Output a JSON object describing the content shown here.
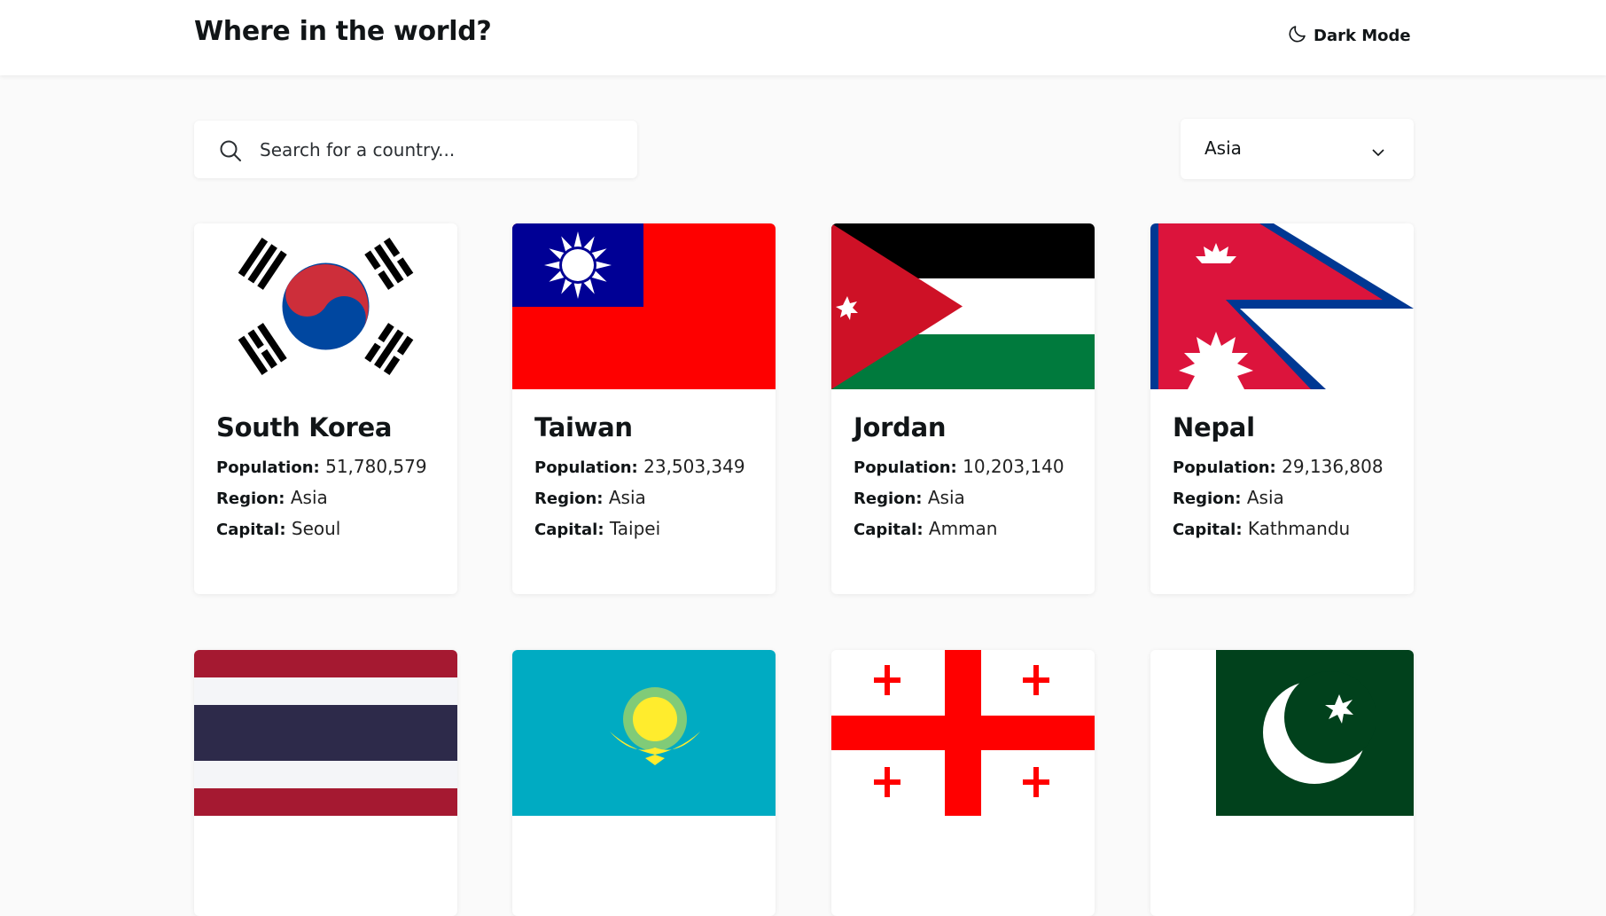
{
  "header": {
    "title": "Where in the world?",
    "dark_mode_label": "Dark Mode"
  },
  "search": {
    "placeholder": "Search for a country...",
    "value": ""
  },
  "filter": {
    "selected": "Asia"
  },
  "labels": {
    "population": "Population:",
    "region": "Region:",
    "capital": "Capital:"
  },
  "countries": [
    {
      "name": "South Korea",
      "population": "51,780,579",
      "region": "Asia",
      "capital": "Seoul"
    },
    {
      "name": "Taiwan",
      "population": "23,503,349",
      "region": "Asia",
      "capital": "Taipei"
    },
    {
      "name": "Jordan",
      "population": "10,203,140",
      "region": "Asia",
      "capital": "Amman"
    },
    {
      "name": "Nepal",
      "population": "29,136,808",
      "region": "Asia",
      "capital": "Kathmandu"
    }
  ],
  "colors": {
    "background": "#fafafa",
    "card": "#ffffff",
    "text": "#111517"
  }
}
